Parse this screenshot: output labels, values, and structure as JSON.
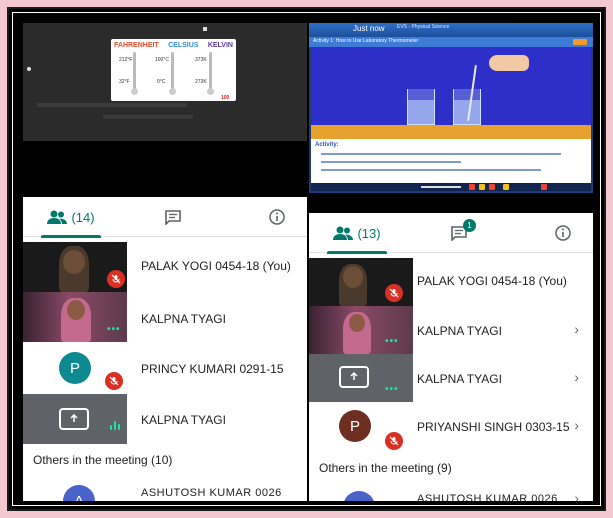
{
  "left": {
    "slide": {
      "headers": [
        "FAHRENHEIT",
        "CELSIUS",
        "KELVIN"
      ],
      "f_values": [
        "212°F",
        "32°F"
      ],
      "c_values": [
        "100°C",
        "0°C"
      ],
      "k_values": [
        "373K",
        "273K"
      ],
      "corner_mark": "100"
    },
    "people_count": "(14)",
    "participants": [
      {
        "name": "PALAK YOGI 0454-18 (You)"
      },
      {
        "name": "KALPNA TYAGI"
      },
      {
        "name": "PRINCY KUMARI 0291-15",
        "initial": "P"
      },
      {
        "name": "KALPNA TYAGI"
      }
    ],
    "others_label": "Others in the meeting (10)",
    "next_name": "ASHUTOSH KUMAR 0026",
    "next_initial": "A"
  },
  "right": {
    "slide": {
      "title": "Just now",
      "subtitle": "EVS - Physical Science",
      "activity": "Activity 1: How to Use Laboratory Thermometer",
      "activity_heading": "Activity:",
      "lines": [
        "Observe the initial level of mercury in the thermometer and note down the readings.",
        "Place the thermometer in hot water.",
        "Observe the change in the mercury level and note down the readings."
      ]
    },
    "people_count": "(13)",
    "chat_badge": "1",
    "participants": [
      {
        "name": "PALAK YOGI 0454-18 (You)"
      },
      {
        "name": "KALPNA TYAGI"
      },
      {
        "name": "KALPNA TYAGI"
      },
      {
        "name": "PRIYANSHI SINGH 0303-15",
        "initial": "P"
      }
    ],
    "others_label": "Others in the meeting (9)",
    "next_name": "ASHUTOSH KUMAR 0026",
    "next_initial": "A"
  },
  "colors": {
    "accent": "#00796b",
    "mute": "#d93025",
    "speaking": "#1ee3a8",
    "avatar_teal": "#0c8a8f",
    "avatar_brown": "#6d2f22",
    "avatar_blue": "#4a63c9"
  },
  "icons": [
    "people-icon",
    "chat-icon",
    "info-icon",
    "mic-off-icon",
    "present-screen-icon",
    "chevron-right-icon",
    "more-dots-icon"
  ]
}
